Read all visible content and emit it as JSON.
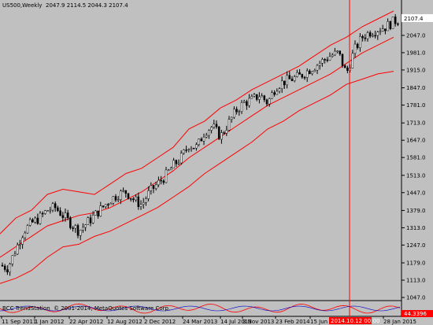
{
  "header": {
    "title": "US500,Weekly",
    "ohlc": "2047.9 2114.5 2044.3 2107.4"
  },
  "price_label": "2107.4",
  "indicator": {
    "label": "BCC TrendStation",
    "copyright": "© 2001-2014, MetaQuotes Software Corp.",
    "value_label": "44.3396"
  },
  "crosshair": {
    "time_label": "2014.10.12 00:00"
  },
  "colors": {
    "background": "#c0c0c0",
    "band": "#ff0000",
    "candle_up": "#ffffff",
    "candle_down": "#000000",
    "grid": "#a8a8a8",
    "scale_bg": "#ffffff",
    "highlight": "#ff0000"
  },
  "chart_data": {
    "type": "candlestick",
    "y_ticks": [
      "2113.0",
      "2047.0",
      "1981.0",
      "1915.0",
      "1847.0",
      "1781.0",
      "1713.0",
      "1647.0",
      "1581.0",
      "1513.0",
      "1447.0",
      "1379.0",
      "1313.0",
      "1247.0",
      "1179.0",
      "1113.0",
      "1047.0"
    ],
    "x_ticks": [
      "11 Sep 2011",
      "1 Jan 2012",
      "22 Apr 2012",
      "12 Aug 2012",
      "2 Dec 2012",
      "24 Mar 2013",
      "14 Jul 2013",
      "3 Nov 2013",
      "23 Feb 2014",
      "15 Jun",
      "28 Jan 2015"
    ],
    "ylim": [
      1047,
      2140
    ],
    "series": [
      {
        "name": "US500,Weekly",
        "kind": "close",
        "points": [
          [
            0,
            1170
          ],
          [
            10,
            1160
          ],
          [
            20,
            1230
          ],
          [
            30,
            1300
          ],
          [
            40,
            1330
          ],
          [
            50,
            1350
          ],
          [
            60,
            1380
          ],
          [
            70,
            1390
          ],
          [
            80,
            1360
          ],
          [
            90,
            1330
          ],
          [
            100,
            1300
          ],
          [
            110,
            1330
          ],
          [
            120,
            1360
          ],
          [
            130,
            1390
          ],
          [
            140,
            1420
          ],
          [
            150,
            1440
          ],
          [
            160,
            1450
          ],
          [
            170,
            1420
          ],
          [
            180,
            1400
          ],
          [
            190,
            1450
          ],
          [
            200,
            1480
          ],
          [
            210,
            1510
          ],
          [
            220,
            1550
          ],
          [
            230,
            1580
          ],
          [
            240,
            1630
          ],
          [
            250,
            1620
          ],
          [
            260,
            1680
          ],
          [
            270,
            1700
          ],
          [
            280,
            1660
          ],
          [
            290,
            1710
          ],
          [
            300,
            1760
          ],
          [
            310,
            1790
          ],
          [
            320,
            1800
          ],
          [
            330,
            1820
          ],
          [
            340,
            1790
          ],
          [
            350,
            1850
          ],
          [
            360,
            1870
          ],
          [
            370,
            1880
          ],
          [
            380,
            1890
          ],
          [
            390,
            1910
          ],
          [
            400,
            1930
          ],
          [
            410,
            1950
          ],
          [
            420,
            1970
          ],
          [
            430,
            1980
          ],
          [
            440,
            1900
          ],
          [
            450,
            1990
          ],
          [
            460,
            2040
          ],
          [
            470,
            2060
          ],
          [
            480,
            2070
          ],
          [
            490,
            2080
          ],
          [
            500,
            2100
          ],
          [
            506,
            2107
          ]
        ]
      },
      {
        "name": "",
        "kind": "upper",
        "points": [
          [
            0,
            1290
          ],
          [
            20,
            1350
          ],
          [
            40,
            1380
          ],
          [
            60,
            1440
          ],
          [
            80,
            1460
          ],
          [
            100,
            1450
          ],
          [
            120,
            1440
          ],
          [
            140,
            1480
          ],
          [
            160,
            1520
          ],
          [
            180,
            1540
          ],
          [
            200,
            1580
          ],
          [
            220,
            1620
          ],
          [
            240,
            1690
          ],
          [
            260,
            1720
          ],
          [
            280,
            1770
          ],
          [
            300,
            1800
          ],
          [
            320,
            1840
          ],
          [
            340,
            1870
          ],
          [
            360,
            1900
          ],
          [
            380,
            1930
          ],
          [
            400,
            1970
          ],
          [
            420,
            2010
          ],
          [
            440,
            2040
          ],
          [
            460,
            2080
          ],
          [
            480,
            2110
          ],
          [
            500,
            2140
          ]
        ]
      },
      {
        "name": "",
        "kind": "middle",
        "points": [
          [
            0,
            1200
          ],
          [
            20,
            1240
          ],
          [
            40,
            1280
          ],
          [
            60,
            1320
          ],
          [
            80,
            1340
          ],
          [
            100,
            1360
          ],
          [
            120,
            1370
          ],
          [
            140,
            1390
          ],
          [
            160,
            1420
          ],
          [
            180,
            1450
          ],
          [
            200,
            1490
          ],
          [
            220,
            1530
          ],
          [
            240,
            1580
          ],
          [
            260,
            1620
          ],
          [
            280,
            1660
          ],
          [
            300,
            1700
          ],
          [
            320,
            1740
          ],
          [
            340,
            1780
          ],
          [
            360,
            1810
          ],
          [
            380,
            1840
          ],
          [
            400,
            1870
          ],
          [
            420,
            1900
          ],
          [
            440,
            1940
          ],
          [
            460,
            1980
          ],
          [
            480,
            2010
          ],
          [
            500,
            2040
          ]
        ]
      },
      {
        "name": "",
        "kind": "lower",
        "points": [
          [
            0,
            1100
          ],
          [
            20,
            1120
          ],
          [
            40,
            1150
          ],
          [
            60,
            1200
          ],
          [
            80,
            1240
          ],
          [
            100,
            1250
          ],
          [
            120,
            1280
          ],
          [
            140,
            1300
          ],
          [
            160,
            1330
          ],
          [
            180,
            1360
          ],
          [
            200,
            1390
          ],
          [
            220,
            1430
          ],
          [
            240,
            1470
          ],
          [
            260,
            1520
          ],
          [
            280,
            1560
          ],
          [
            300,
            1600
          ],
          [
            320,
            1640
          ],
          [
            340,
            1690
          ],
          [
            360,
            1720
          ],
          [
            380,
            1760
          ],
          [
            400,
            1790
          ],
          [
            420,
            1820
          ],
          [
            440,
            1860
          ],
          [
            460,
            1880
          ],
          [
            480,
            1900
          ],
          [
            500,
            1910
          ]
        ]
      }
    ]
  }
}
